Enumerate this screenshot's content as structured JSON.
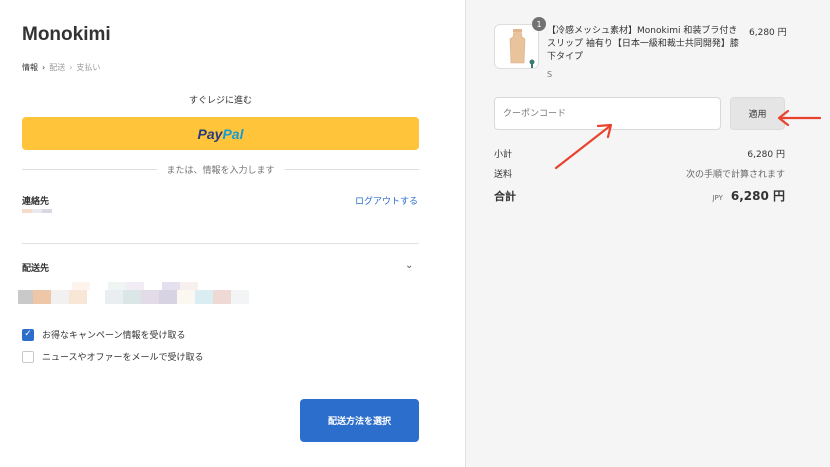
{
  "store": {
    "name": "Monokimi"
  },
  "breadcrumb": {
    "items": [
      "情報",
      "配送",
      "支払い"
    ]
  },
  "express": {
    "title": "すぐレジに進む",
    "paypal_a": "Pay",
    "paypal_b": "Pal",
    "divider": "または、情報を入力します"
  },
  "contact": {
    "label": "連絡先",
    "logout": "ログアウトする"
  },
  "shipping": {
    "label": "配送先"
  },
  "checkboxes": [
    {
      "label": "お得なキャンペーン情報を受け取る",
      "checked": true
    },
    {
      "label": "ニュースやオファーをメールで受け取る",
      "checked": false
    }
  ],
  "continue_button": "配送方法を選択",
  "cart": {
    "item": {
      "quantity": "1",
      "name": "【冷感メッシュ素材】Monokimi 和装ブラ付きスリップ 袖有り【日本一級和裁士共同開発】膝下タイプ",
      "variant": "S",
      "price": "6,280 円"
    },
    "coupon_placeholder": "クーポンコード",
    "apply_label": "適用",
    "subtotal_label": "小計",
    "subtotal_value": "6,280 円",
    "shipping_label": "送料",
    "shipping_value": "次の手順で計算されます",
    "total_label": "合計",
    "total_currency": "JPY",
    "total_value": "6,280 円"
  },
  "colors": {
    "accent": "#2c6ecb",
    "paypal": "#ffc439",
    "annotation_arrow": "#e8432e"
  },
  "icons": {
    "breadcrumb_separator": "chevron-right-icon",
    "shipping_toggle": "chevron-down-icon",
    "checkbox_checked": "checkmark-icon"
  }
}
